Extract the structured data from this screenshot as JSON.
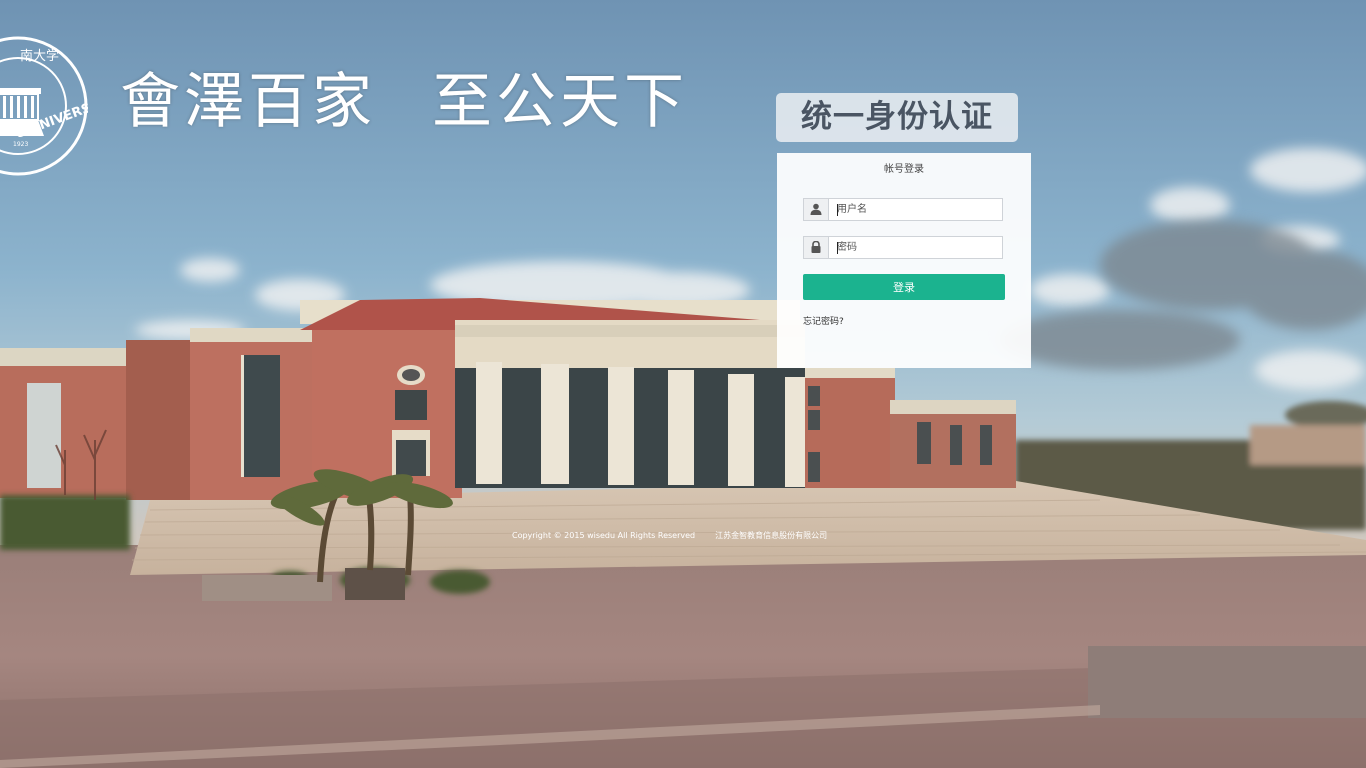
{
  "header": {
    "seal_text": "U UNIVERSITY",
    "seal_year": "1923",
    "seal_top_text": "南大学",
    "motto_part1": "會澤百家",
    "motto_part2": "至公天下",
    "system_title": "统一身份认证"
  },
  "login": {
    "panel_title": "帐号登录",
    "username_placeholder": "用户名",
    "password_placeholder": "密码",
    "submit_label": "登录",
    "forgot_link": "忘记密码?",
    "accent_color": "#1bb38f"
  },
  "footer": {
    "copyright": "Copyright © 2015 wisedu All Rights Reserved",
    "company": "江苏金智教育信息股份有限公司"
  },
  "icons": {
    "username": "user-icon",
    "password": "lock-icon"
  }
}
